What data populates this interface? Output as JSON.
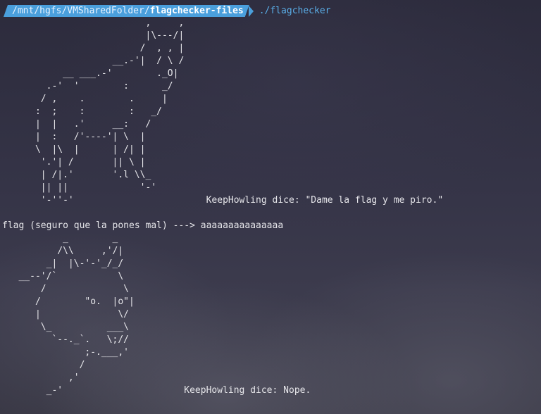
{
  "prompt": {
    "path_prefix": "/mnt/hgfs/VMSharedFolder/",
    "path_last": "flagchecker-files",
    "command": "./flagchecker"
  },
  "output": {
    "art_1": "                          ,     ,\n                          |\\---/|\n                         /  , , |\n                    __.-'|  / \\ /\n           __ ___.-'        ._O|\n        .-'  '        :      _/\n       / ,    .        .     |\n      :  ;    :        :   _/\n      |  |   .'     __:   /\n      |  :   /'----'| \\  |\n      \\  |\\  |      | /| |\n       '.'| /       || \\ |\n       | /|.'       '.l \\\\_\n       || ||             '-'\n       '-''-'",
    "message_1": "KeepHowling dice: \"Dame la flag y me piro.\"",
    "input_prompt": "flag (seguro que la pones mal) --->",
    "input_value": "aaaaaaaaaaaaaaa",
    "art_2": "           _        _\n          /\\\\     ,'/|\n        _|  |\\-'-'_/_/\n   __--'/`           \\\n       /              \\\n      /        \"o.  |o\"|\n      |              \\/\n       \\_          ___\\\n         `--._`.   \\;//\n               ;-.___,'\n              /\n            ,'\n        _-'",
    "message_2": "KeepHowling dice: Nope."
  }
}
